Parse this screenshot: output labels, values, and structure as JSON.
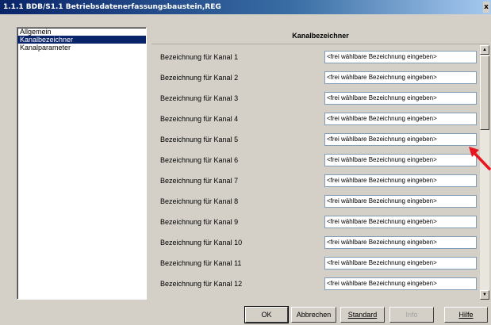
{
  "window": {
    "title": "1.1.1 BDB/S1.1 Betriebsdatenerfassungsbaustein,REG",
    "close_label": "x"
  },
  "sidebar": {
    "items": [
      {
        "label": "Allgemein",
        "selected": false
      },
      {
        "label": "Kanalbezeichner",
        "selected": true
      },
      {
        "label": "Kanalparameter",
        "selected": false
      }
    ]
  },
  "panel": {
    "title": "Kanalbezeichner",
    "rows": [
      {
        "label": "Bezeichnung für Kanal 1",
        "value": "<frei wählbare Bezeichnung eingeben>"
      },
      {
        "label": "Bezeichnung für Kanal 2",
        "value": "<frei wählbare Bezeichnung eingeben>"
      },
      {
        "label": "Bezeichnung für Kanal 3",
        "value": "<frei wählbare Bezeichnung eingeben>"
      },
      {
        "label": "Bezeichnung für Kanal 4",
        "value": "<frei wählbare Bezeichnung eingeben>"
      },
      {
        "label": "Bezeichnung für Kanal 5",
        "value": "<frei wählbare Bezeichnung eingeben>"
      },
      {
        "label": "Bezeichnung für Kanal 6",
        "value": "<frei wählbare Bezeichnung eingeben>"
      },
      {
        "label": "Bezeichnung für Kanal 7",
        "value": "<frei wählbare Bezeichnung eingeben>"
      },
      {
        "label": "Bezeichnung für Kanal 8",
        "value": "<frei wählbare Bezeichnung eingeben>"
      },
      {
        "label": "Bezeichnung für Kanal 9",
        "value": "<frei wählbare Bezeichnung eingeben>"
      },
      {
        "label": "Bezeichnung für Kanal 10",
        "value": "<frei wählbare Bezeichnung eingeben>"
      },
      {
        "label": "Bezeichnung für Kanal 11",
        "value": "<frei wählbare Bezeichnung eingeben>"
      },
      {
        "label": "Bezeichnung für Kanal 12",
        "value": "<frei wählbare Bezeichnung eingeben>"
      }
    ]
  },
  "buttons": {
    "ok": "OK",
    "cancel": "Abbrechen",
    "standard": "Standard",
    "info": "Info",
    "help": "Hilfe"
  },
  "scrollbar": {
    "up_glyph": "▲",
    "down_glyph": "▼"
  },
  "colors": {
    "selection": "#0a246a",
    "annotation_arrow": "#e8141e"
  }
}
